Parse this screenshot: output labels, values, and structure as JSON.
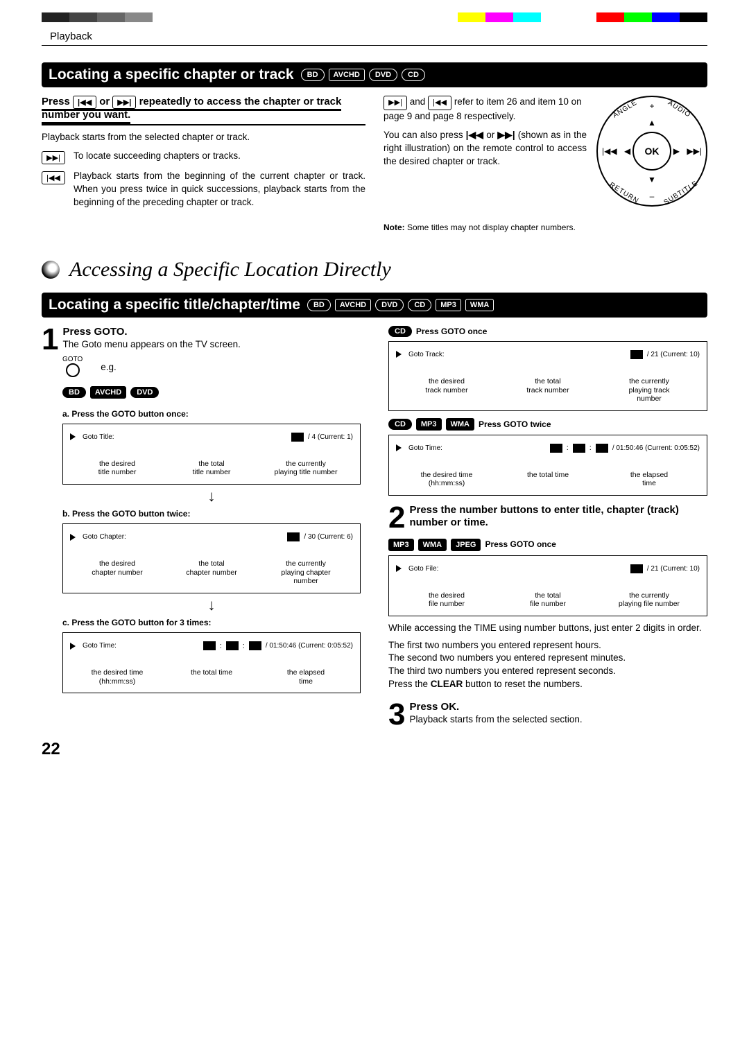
{
  "header_section": "Playback",
  "page_number": "22",
  "color_bar": [
    "#222",
    "#444",
    "#666",
    "#888",
    "#fff",
    "#fff",
    "#fff",
    "#fff",
    "#fff",
    "#fff",
    "#fff",
    "#fff",
    "#fff",
    "#fff",
    "#fff",
    "#ff0",
    "#f0f",
    "#0ff",
    "#fff",
    "#fff",
    "#f00",
    "#0f0",
    "#00f",
    "#000"
  ],
  "section1": {
    "title": "Locating a specific chapter or track",
    "badges": [
      "BD",
      "AVCHD",
      "DVD",
      "CD"
    ],
    "left": {
      "lead_a": "Press ",
      "lead_b": " or ",
      "lead_c": " repeatedly to access the chapter or track number you want.",
      "body1": "Playback starts from the selected chapter or track.",
      "row1": "To locate succeeding chapters or tracks.",
      "row2": "Playback starts from the beginning of the current chapter or track. When you press twice in quick successions, playback starts from the beginning of the preceding chapter or track."
    },
    "right": {
      "text_a": " and ",
      "text_b": " refer to item 26 and item 10 on page 9 and page 8 respectively.",
      "text_c": "You can also press ",
      "text_d": " or ",
      "text_e": " (shown as in the right illustration) on the remote control to access the desired chapter or track.",
      "note_label": "Note:",
      "note": " Some titles may not display chapter numbers.",
      "ring_labels": {
        "ok": "OK",
        "angle": "ANGLE",
        "audio": "AUDIO",
        "return": "RETURN",
        "subtitle": "SUBTITLE",
        "plus": "+",
        "minus": "–"
      }
    }
  },
  "accessing_title": "Accessing a Specific Location Directly",
  "section2": {
    "title": "Locating a specific title/chapter/time",
    "badges": [
      "BD",
      "AVCHD",
      "DVD",
      "CD",
      "MP3",
      "WMA"
    ]
  },
  "steps": {
    "s1": {
      "head": "Press GOTO.",
      "body": "The Goto menu appears on the TV screen.",
      "eg": "e.g.",
      "goto_label": "GOTO",
      "badges_under": [
        "BD",
        "AVCHD",
        "DVD"
      ],
      "a_head": "a. Press the GOTO button once:",
      "a_line": {
        "label": "Goto Title:",
        "value": "/ 4 (Current: 1)"
      },
      "a_labels": [
        "the desired\ntitle number",
        "the total\ntitle number",
        "the currently\nplaying title number"
      ],
      "b_head": "b. Press the GOTO button twice:",
      "b_line": {
        "label": "Goto Chapter:",
        "value": "/ 30 (Current: 6)"
      },
      "b_labels": [
        "the desired\nchapter number",
        "the total\nchapter number",
        "the currently\nplaying chapter\nnumber"
      ],
      "c_head": "c. Press the GOTO button for 3 times:",
      "c_line": {
        "label": "Goto Time:",
        "value": "/ 01:50:46 (Current: 0:05:52)"
      },
      "c_labels": [
        "the desired time\n(hh:mm:ss)",
        "the total time",
        "the elapsed\ntime"
      ]
    },
    "s2": {
      "head": "Press the number buttons to enter title, chapter (track) number or time.",
      "cd_once_badges": [
        "CD"
      ],
      "cd_once_label": "Press GOTO once",
      "cd_once_line": {
        "label": "Goto Track:",
        "value": "/ 21 (Current: 10)"
      },
      "cd_once_labels": [
        "the desired\ntrack number",
        "the total\ntrack number",
        "the currently\nplaying track\nnumber"
      ],
      "cd_twice_badges": [
        "CD",
        "MP3",
        "WMA"
      ],
      "cd_twice_label": "Press GOTO twice",
      "cd_twice_line": {
        "label": "Goto Time:",
        "value": "/ 01:50:46 (Current: 0:05:52)"
      },
      "cd_twice_labels": [
        "the desired time\n(hh:mm:ss)",
        "the total time",
        "the elapsed\ntime"
      ],
      "file_badges": [
        "MP3",
        "WMA",
        "JPEG"
      ],
      "file_label": "Press GOTO once",
      "file_line": {
        "label": "Goto File:",
        "value": "/ 21 (Current: 10)"
      },
      "file_labels": [
        "the desired\nfile number",
        "the total\nfile number",
        "the currently\nplaying file number"
      ],
      "body1": "While accessing the TIME using number buttons, just enter 2 digits in order.",
      "body2": "The first two numbers you entered represent hours.",
      "body3": "The second two numbers you entered represent minutes.",
      "body4": "The third two numbers you entered represent seconds.",
      "body5a": "Press the ",
      "body5b": "CLEAR",
      "body5c": " button to reset the numbers."
    },
    "s3": {
      "head": "Press OK.",
      "body": "Playback starts from the selected section."
    }
  }
}
